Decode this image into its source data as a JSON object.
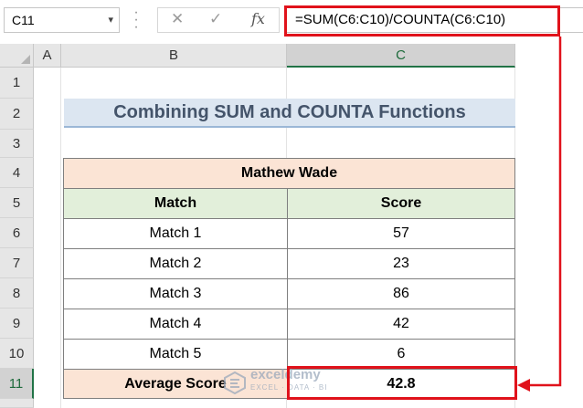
{
  "formula_bar": {
    "name_box": "C11",
    "cancel_icon": "x-icon",
    "enter_icon": "check-icon",
    "fx_label": "fx",
    "formula": "=SUM(C6:C10)/COUNTA(C6:C10)"
  },
  "columns": [
    "A",
    "B",
    "C"
  ],
  "rows": [
    "1",
    "2",
    "3",
    "4",
    "5",
    "6",
    "7",
    "8",
    "9",
    "10",
    "11"
  ],
  "selected_cell": {
    "column": "C",
    "row": "11"
  },
  "sheet": {
    "title": "Combining SUM and COUNTA Functions",
    "table": {
      "player": "Mathew Wade",
      "headers": {
        "match": "Match",
        "score": "Score"
      },
      "rows": [
        {
          "match": "Match 1",
          "score": "57"
        },
        {
          "match": "Match 2",
          "score": "23"
        },
        {
          "match": "Match 3",
          "score": "86"
        },
        {
          "match": "Match 4",
          "score": "42"
        },
        {
          "match": "Match 5",
          "score": "6"
        }
      ],
      "average_label": "Average Score",
      "average_value": "42.8"
    }
  },
  "watermark": {
    "name": "exceldemy",
    "tagline": "EXCEL · DATA · BI"
  },
  "colors": {
    "highlight_red": "#e0121b",
    "title_fill": "#dce6f1",
    "title_text": "#44546a",
    "header_peach": "#fbe4d5",
    "header_green": "#e2efda"
  }
}
